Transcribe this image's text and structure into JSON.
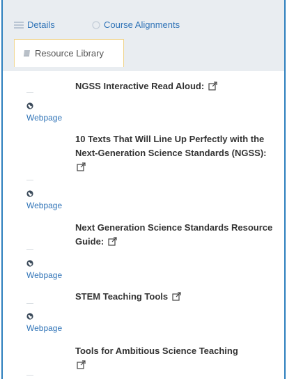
{
  "tabs": {
    "details": "Details",
    "course_alignments": "Course Alignments",
    "resource_library": "Resource Library"
  },
  "resources": [
    {
      "title": "NGSS Interactive Read Aloud:",
      "type": "Webpage"
    },
    {
      "title": "10 Texts That Will Line Up Perfectly with the Next-Generation Science Standards (NGSS):",
      "type": "Webpage"
    },
    {
      "title": "Next Generation Science Standards Resource Guide:",
      "type": "Webpage"
    },
    {
      "title": "STEM Teaching Tools",
      "type": "Webpage"
    },
    {
      "title": "Tools for Ambitious Science Teaching",
      "type": ""
    }
  ],
  "colors": {
    "accent": "#2f73b7",
    "frame": "#2c7fbd",
    "tabbar_bg": "#e9edf1",
    "active_tab_border": "#f0d48a"
  }
}
